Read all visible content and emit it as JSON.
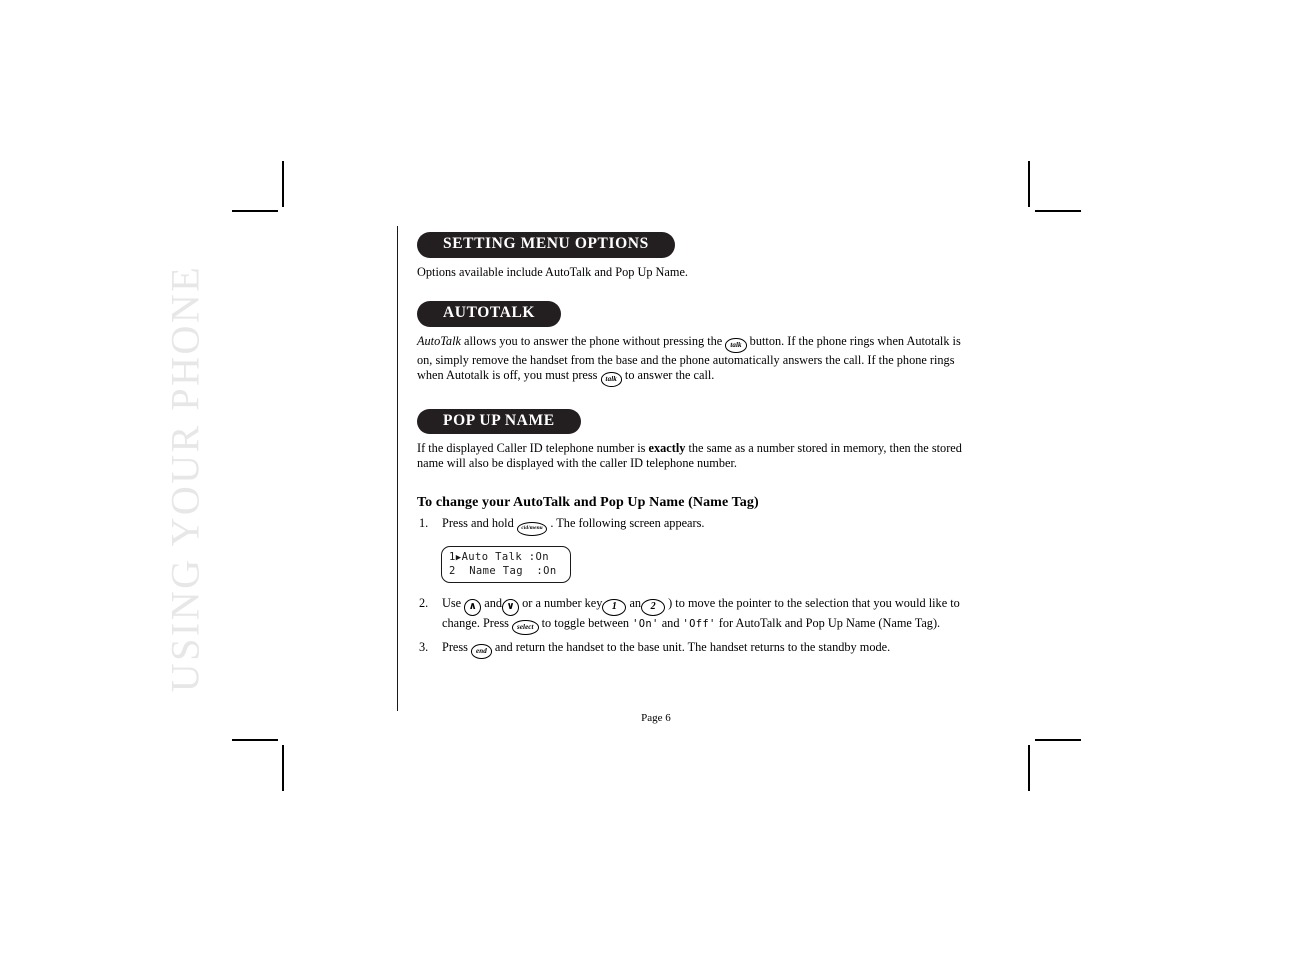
{
  "chapter": {
    "vertical_title": "USING YOUR PHONE"
  },
  "sections": [
    {
      "id": "setting-menu-options",
      "heading": "SETTING MENU OPTIONS",
      "paragraphs": [
        "Options available include AutoTalk and Pop Up Name."
      ]
    },
    {
      "id": "autotalk",
      "heading": "AUTOTALK",
      "paragraph_parts": {
        "lead_italic": "AutoTalk",
        "text_1": " allows you to answer the phone without pressing the ",
        "key_1": "talk",
        "text_2": " button. If the phone rings when Autotalk is on, simply remove the handset from the base and the phone automatically answers the call. If the phone rings when Autotalk is off, you must press ",
        "key_2": "talk",
        "text_3": " to answer the call."
      }
    },
    {
      "id": "pop-up-name",
      "heading": "POP UP NAME",
      "paragraph_parts": {
        "text_1": "If the displayed Caller ID telephone number is ",
        "bold_1": "exactly",
        "text_2": " the same as a number stored in memory, then the stored name will also be displayed with the caller ID telephone number."
      }
    }
  ],
  "procedure": {
    "subheading": "To change your AutoTalk and Pop Up Name (Name Tag)",
    "steps": [
      {
        "number": "1.",
        "text_1": "Press and hold ",
        "key_1": "cid/menu",
        "text_2": " . The following screen appears."
      },
      {
        "number": "2.",
        "text_1": "Use ",
        "key_up": "∧",
        "text_2": " and",
        "key_down": "∨",
        "text_3": " or a number key",
        "key_one": "1",
        "text_4": "  an",
        "key_two": "2",
        "text_5": "  ) to move the pointer to the selection that you would like to change. Press ",
        "key_select": "select",
        "text_6": " to toggle between ",
        "value_on": "'On'",
        "text_7": " and ",
        "value_off": "'Off'",
        "text_8": " for AutoTalk and Pop Up Name (Name Tag)."
      },
      {
        "number": "3.",
        "text_1": "Press ",
        "key_end": "end",
        "text_2": " and return the handset to the base unit. The handset returns to the standby mode."
      }
    ]
  },
  "lcd_screen": {
    "line_1_index": "1",
    "line_1_pointer": "▶",
    "line_1_label": "Auto Talk",
    "line_1_value": ":On",
    "line_2_index": "2",
    "line_2_pointer": " ",
    "line_2_label": "Name Tag",
    "line_2_value": ":On"
  },
  "footer": {
    "page_label": "Page 6"
  },
  "colors": {
    "pill_background": "#231f20",
    "pill_text": "#ffffff",
    "chapter_title": "#e7e7e7",
    "body_text": "#000000",
    "rule": "#1a1a1a"
  }
}
